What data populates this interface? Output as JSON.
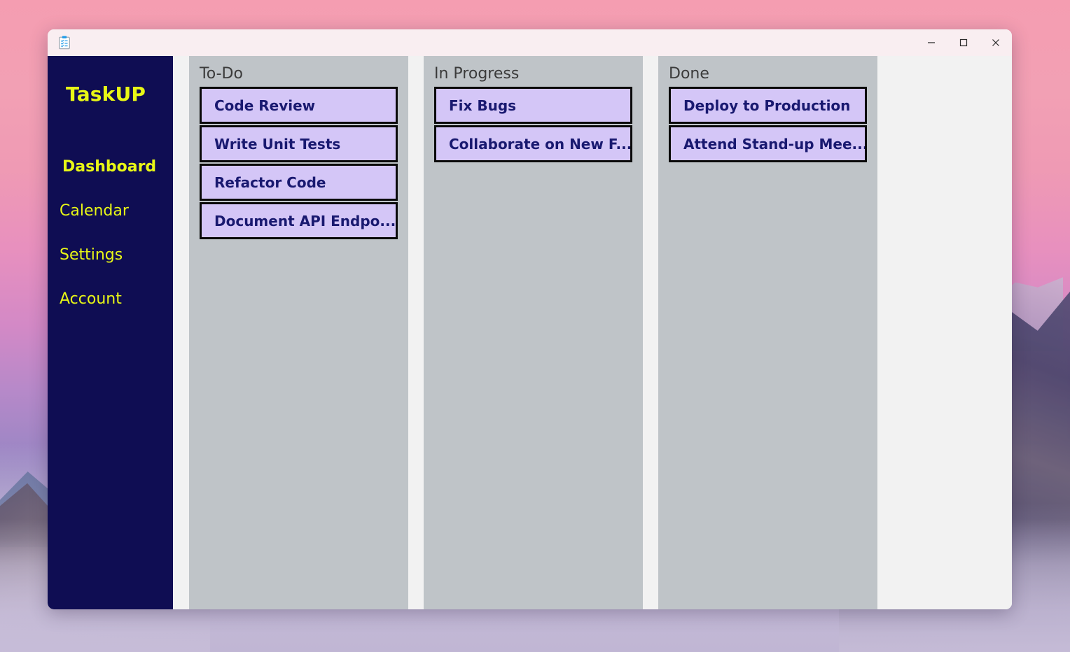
{
  "window": {
    "app_icon": "clipboard-task-icon",
    "controls": {
      "minimize": "−",
      "maximize": "□",
      "close": "✕"
    }
  },
  "sidebar": {
    "brand": "TaskUP",
    "items": [
      {
        "label": "Dashboard",
        "active": true
      },
      {
        "label": "Calendar",
        "active": false
      },
      {
        "label": "Settings",
        "active": false
      },
      {
        "label": "Account",
        "active": false
      }
    ]
  },
  "board": {
    "columns": [
      {
        "title": "To-Do",
        "cards": [
          {
            "label": "Code Review"
          },
          {
            "label": "Write Unit Tests"
          },
          {
            "label": "Refactor Code"
          },
          {
            "label": "Document API Endpo..."
          }
        ]
      },
      {
        "title": "In Progress",
        "cards": [
          {
            "label": "Fix Bugs"
          },
          {
            "label": "Collaborate on New F..."
          }
        ]
      },
      {
        "title": "Done",
        "cards": [
          {
            "label": "Deploy to Production"
          },
          {
            "label": "Attend Stand-up Mee..."
          }
        ]
      }
    ]
  },
  "colors": {
    "sidebar_bg": "#0f0d53",
    "sidebar_text": "#e8f716",
    "column_bg": "#bfc4c8",
    "card_bg": "#d4c6f7",
    "card_border": "#0a0a0a",
    "card_text": "#191970",
    "titlebar_bg": "#f9eef1",
    "window_bg": "#f2f2f2"
  }
}
